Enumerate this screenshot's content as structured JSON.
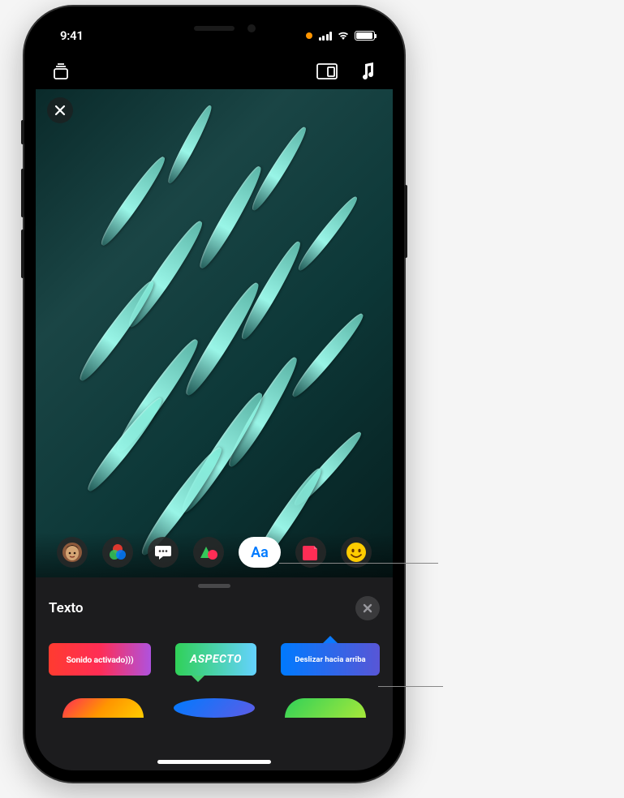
{
  "status": {
    "time": "9:41",
    "recording": true
  },
  "nav": {
    "left_icon": "stack-icon",
    "layout_icon": "layout-icon",
    "music_icon": "music-icon"
  },
  "media": {
    "close_label": "×"
  },
  "effects": {
    "items": [
      {
        "name": "memoji",
        "selected": false
      },
      {
        "name": "filters",
        "selected": false
      },
      {
        "name": "text-bubble",
        "selected": false
      },
      {
        "name": "shapes",
        "selected": false
      },
      {
        "name": "text",
        "selected": true,
        "glyph": "Aa"
      },
      {
        "name": "stickers",
        "selected": false
      },
      {
        "name": "emoji",
        "selected": false
      }
    ]
  },
  "panel": {
    "title": "Texto",
    "close_glyph": "×",
    "stickers": [
      {
        "label": "Sonido activado)))"
      },
      {
        "label": "ASPECTO"
      },
      {
        "label": "Deslizar hacia arriba"
      }
    ]
  }
}
